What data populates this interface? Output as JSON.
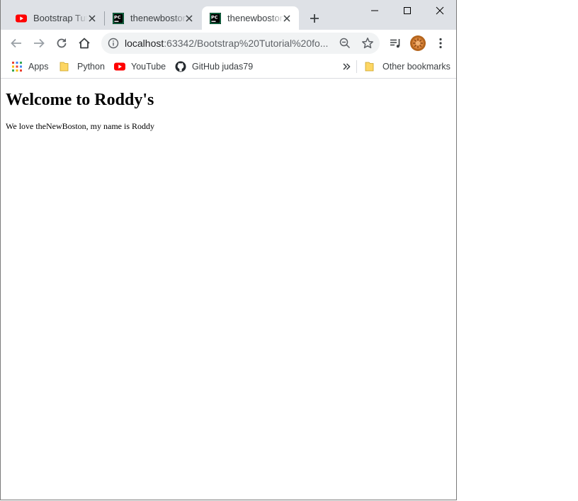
{
  "tabs": [
    {
      "title": "Bootstrap Tutorial",
      "icon": "youtube-icon",
      "active": false
    },
    {
      "title": "thenewboston",
      "icon": "pycharm-icon",
      "active": false
    },
    {
      "title": "thenewboston",
      "icon": "pycharm-icon",
      "active": true
    }
  ],
  "address_bar": {
    "host": "localhost",
    "rest": ":63342/Bootstrap%20Tutorial%20fo..."
  },
  "bookmarks": {
    "items": [
      {
        "label": "Apps",
        "icon": "apps-grid-icon"
      },
      {
        "label": "Python",
        "icon": "folder-icon"
      },
      {
        "label": "YouTube",
        "icon": "youtube-icon"
      },
      {
        "label": "GitHub judas79",
        "icon": "github-icon"
      }
    ],
    "other": "Other bookmarks"
  },
  "page": {
    "heading": "Welcome to Roddy's",
    "paragraph": "We love theNewBoston, my name is Roddy"
  },
  "colors": {
    "titlebar_bg": "#dee1e6",
    "youtube_red": "#ff0000",
    "folder_yellow": "#fdd663",
    "pycharm_green": "#21d789"
  }
}
